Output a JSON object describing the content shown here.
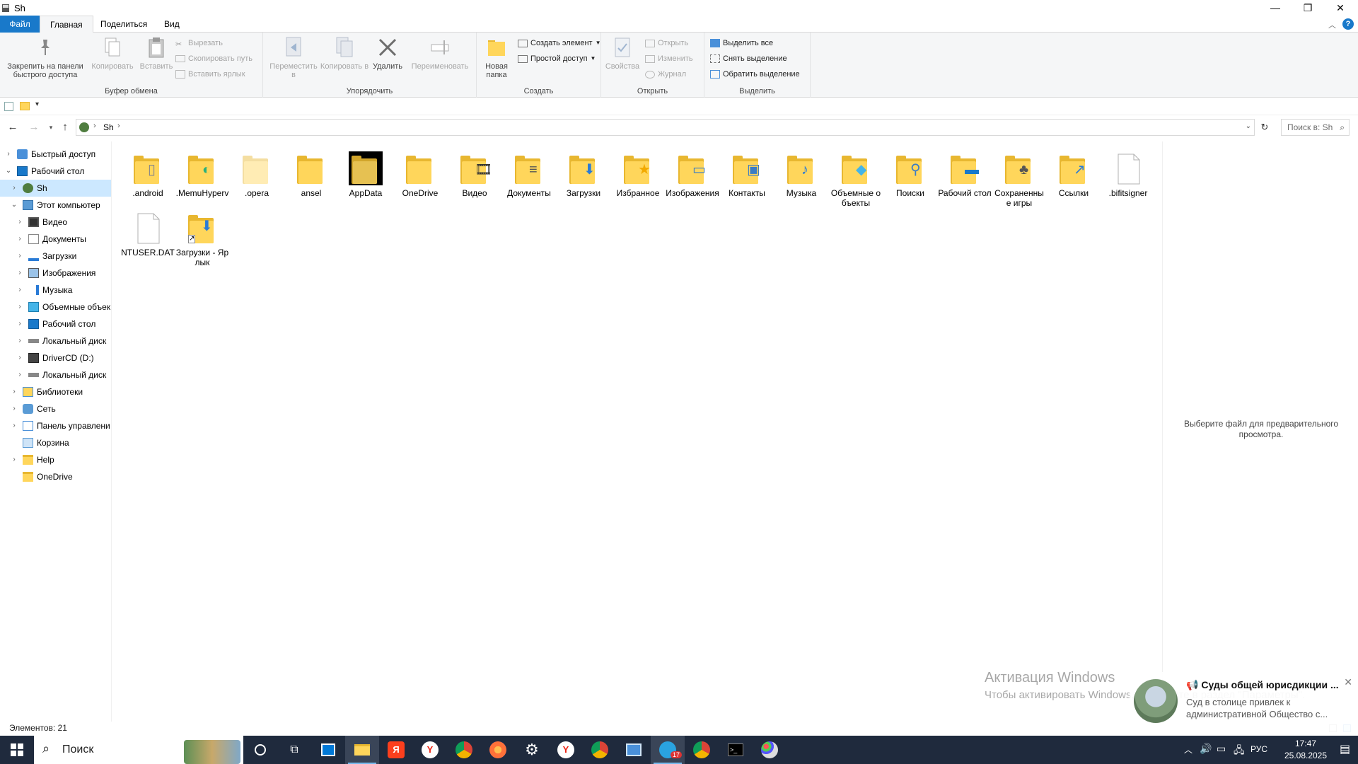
{
  "window": {
    "title": "Sh",
    "minimize": "—",
    "restore": "❐",
    "close": "✕"
  },
  "tabs": {
    "file": "Файл",
    "home": "Главная",
    "share": "Поделиться",
    "view": "Вид"
  },
  "ribbon": {
    "clipboard": {
      "label": "Буфер обмена",
      "pin": "Закрепить на панели быстрого доступа",
      "copy": "Копировать",
      "paste": "Вставить",
      "cut": "Вырезать",
      "copy_path": "Скопировать путь",
      "paste_shortcut": "Вставить ярлык"
    },
    "organize": {
      "label": "Упорядочить",
      "move_to": "Переместить в",
      "copy_to": "Копировать в",
      "delete": "Удалить",
      "rename": "Переименовать"
    },
    "create": {
      "label": "Создать",
      "new_folder": "Новая папка",
      "new_item": "Создать элемент",
      "easy_access": "Простой доступ"
    },
    "open": {
      "label": "Открыть",
      "properties": "Свойства",
      "open": "Открыть",
      "edit": "Изменить",
      "history": "Журнал"
    },
    "select": {
      "label": "Выделить",
      "select_all": "Выделить все",
      "select_none": "Снять выделение",
      "invert": "Обратить выделение"
    }
  },
  "address": {
    "path": "Sh",
    "search_placeholder": "Поиск в: Sh"
  },
  "nav": [
    {
      "label": "Быстрый доступ"
    },
    {
      "label": "Рабочий стол"
    },
    {
      "label": "Sh"
    },
    {
      "label": "Этот компьютер"
    },
    {
      "label": "Видео"
    },
    {
      "label": "Документы"
    },
    {
      "label": "Загрузки"
    },
    {
      "label": "Изображения"
    },
    {
      "label": "Музыка"
    },
    {
      "label": "Объемные объек"
    },
    {
      "label": "Рабочий стол"
    },
    {
      "label": "Локальный диск"
    },
    {
      "label": "DriverCD (D:)"
    },
    {
      "label": "Локальный диск"
    },
    {
      "label": "Библиотеки"
    },
    {
      "label": "Сеть"
    },
    {
      "label": "Панель управлени"
    },
    {
      "label": "Корзина"
    },
    {
      "label": "Help"
    },
    {
      "label": "OneDrive"
    }
  ],
  "files": [
    {
      "name": ".android"
    },
    {
      "name": ".MemuHyperv"
    },
    {
      "name": ".opera"
    },
    {
      "name": "ansel"
    },
    {
      "name": "AppData"
    },
    {
      "name": "OneDrive"
    },
    {
      "name": "Видео"
    },
    {
      "name": "Документы"
    },
    {
      "name": "Загрузки"
    },
    {
      "name": "Избранное"
    },
    {
      "name": "Изображения"
    },
    {
      "name": "Контакты"
    },
    {
      "name": "Музыка"
    },
    {
      "name": "Объемные объекты"
    },
    {
      "name": "Поиски"
    },
    {
      "name": "Рабочий стол"
    },
    {
      "name": "Сохраненные игры"
    },
    {
      "name": "Ссылки"
    },
    {
      "name": ".bifitsigner"
    },
    {
      "name": "NTUSER.DAT"
    },
    {
      "name": "Загрузки - Ярлык"
    }
  ],
  "preview_text": "Выберите файл для предварительного просмотра.",
  "status": {
    "count": "Элементов: 21"
  },
  "activation": {
    "line1": "Активация Windows",
    "line2": "Чтобы активировать Windows, перейдите в раздел \"Параметры\"."
  },
  "notification": {
    "title": "Суды общей юрисдикции ...",
    "body": "Суд в столице привлек к административной Общество с...",
    "close": "✕"
  },
  "taskbar": {
    "search": "Поиск",
    "lang": "РУС",
    "time": "17:47",
    "date": "25.08.2025",
    "telegram_badge": "17"
  },
  "colors": {
    "accent": "#1979ca",
    "folder": "#ffd65b",
    "selection": "#cce8ff",
    "taskbar": "#1f2a3d"
  }
}
